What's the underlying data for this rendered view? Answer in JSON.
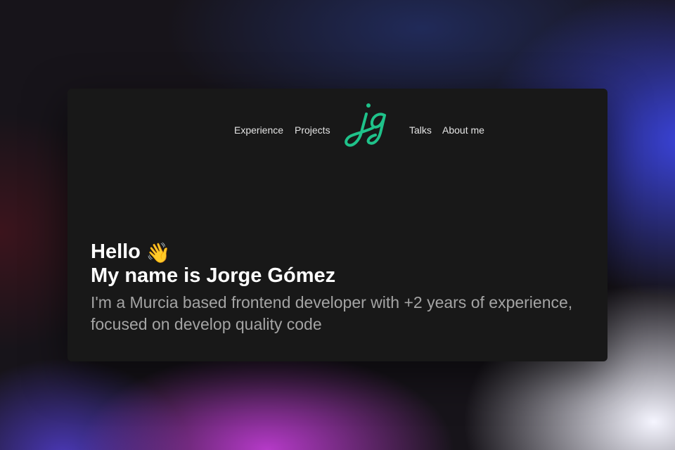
{
  "nav": {
    "links": [
      {
        "label": "Experience"
      },
      {
        "label": "Projects"
      },
      {
        "label": "Talks"
      },
      {
        "label": "About me"
      }
    ],
    "logo": {
      "text": "jg",
      "color": "#1fc28a",
      "icon": "jg-monogram-logo"
    }
  },
  "hero": {
    "greeting": "Hello",
    "wave_emoji": "👋",
    "title": "My name is Jorge Gómez",
    "description": "I'm a Murcia based frontend developer with +2 years of experience, focused on develop quality code"
  },
  "colors": {
    "card_background": "#181818",
    "heading": "#ffffff",
    "body_text": "#a4a4a4",
    "nav_text": "#e4e4e4",
    "accent": "#1fc28a"
  }
}
